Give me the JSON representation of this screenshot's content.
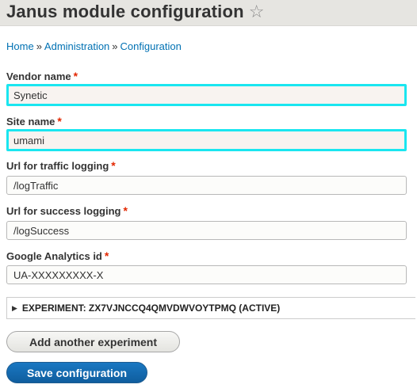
{
  "header": {
    "title": "Janus module configuration",
    "star_icon": "star-outline-icon"
  },
  "breadcrumb": {
    "items": [
      "Home",
      "Administration",
      "Configuration"
    ],
    "separator": "»"
  },
  "form": {
    "required_marker": "*",
    "fields": [
      {
        "label": "Vendor name",
        "value": "Synetic"
      },
      {
        "label": "Site name",
        "value": "umami"
      },
      {
        "label": "Url for traffic logging",
        "value": "/logTraffic"
      },
      {
        "label": "Url for success logging",
        "value": "/logSuccess"
      },
      {
        "label": "Google Analytics id",
        "value": "UA-XXXXXXXXX-X"
      }
    ],
    "experiment_summary": "EXPERIMENT: ZX7VJNCCQ4QMVDWVOYTPMQ (ACTIVE)",
    "add_experiment_label": "Add another experiment",
    "save_label": "Save configuration"
  },
  "colors": {
    "link": "#0071b3",
    "required": "#e32700",
    "highlight_border": "#1ae6f0",
    "primary_button": "#1a78c2",
    "header_bg": "#e6e5e1"
  }
}
